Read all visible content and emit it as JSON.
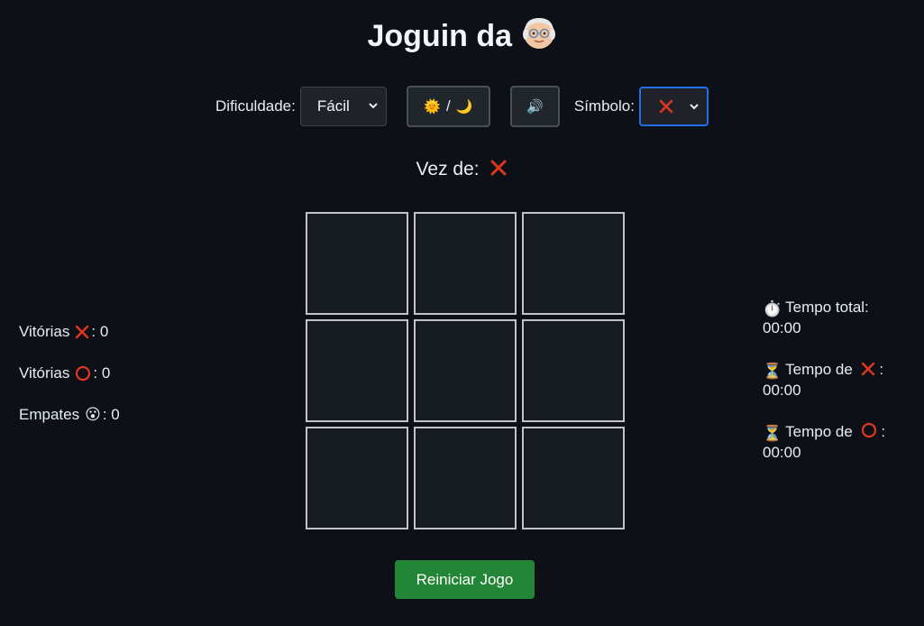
{
  "header": {
    "title": "Joguin da",
    "title_icon": "older-person-emoji"
  },
  "controls": {
    "difficulty_label": "Dificuldade:",
    "difficulty_value": "Fácil",
    "theme_sun": "🌞",
    "theme_separator": "/",
    "theme_moon": "🌙",
    "sound_icon": "🔊",
    "symbol_label": "Símbolo:",
    "symbol_value": "X"
  },
  "turn": {
    "label": "Vez de:",
    "current": "X"
  },
  "board": {
    "cells": [
      "",
      "",
      "",
      "",
      "",
      "",
      "",
      "",
      ""
    ]
  },
  "scores": {
    "wins_x_label": "Vitórias",
    "wins_x_value": ": 0",
    "wins_o_label": "Vitórias",
    "wins_o_value": ": 0",
    "draws_label": "Empates",
    "draws_emoji": "😮",
    "draws_value": ": 0"
  },
  "timers": {
    "total_icon": "⏱️",
    "total_label": "Tempo total:",
    "total_value": "00:00",
    "x_icon": "⏳",
    "x_label": "Tempo de",
    "x_suffix": ":",
    "x_value": "00:00",
    "o_icon": "⏳",
    "o_label": "Tempo de",
    "o_suffix": ":",
    "o_value": "00:00"
  },
  "actions": {
    "restart_label": "Reiniciar Jogo"
  },
  "colors": {
    "background": "#0d1117",
    "cell_background": "#161b22",
    "x_mark": "#e0371f",
    "o_mark": "#e0371f",
    "restart_button": "#238636",
    "symbol_select_border": "#1f6feb"
  }
}
